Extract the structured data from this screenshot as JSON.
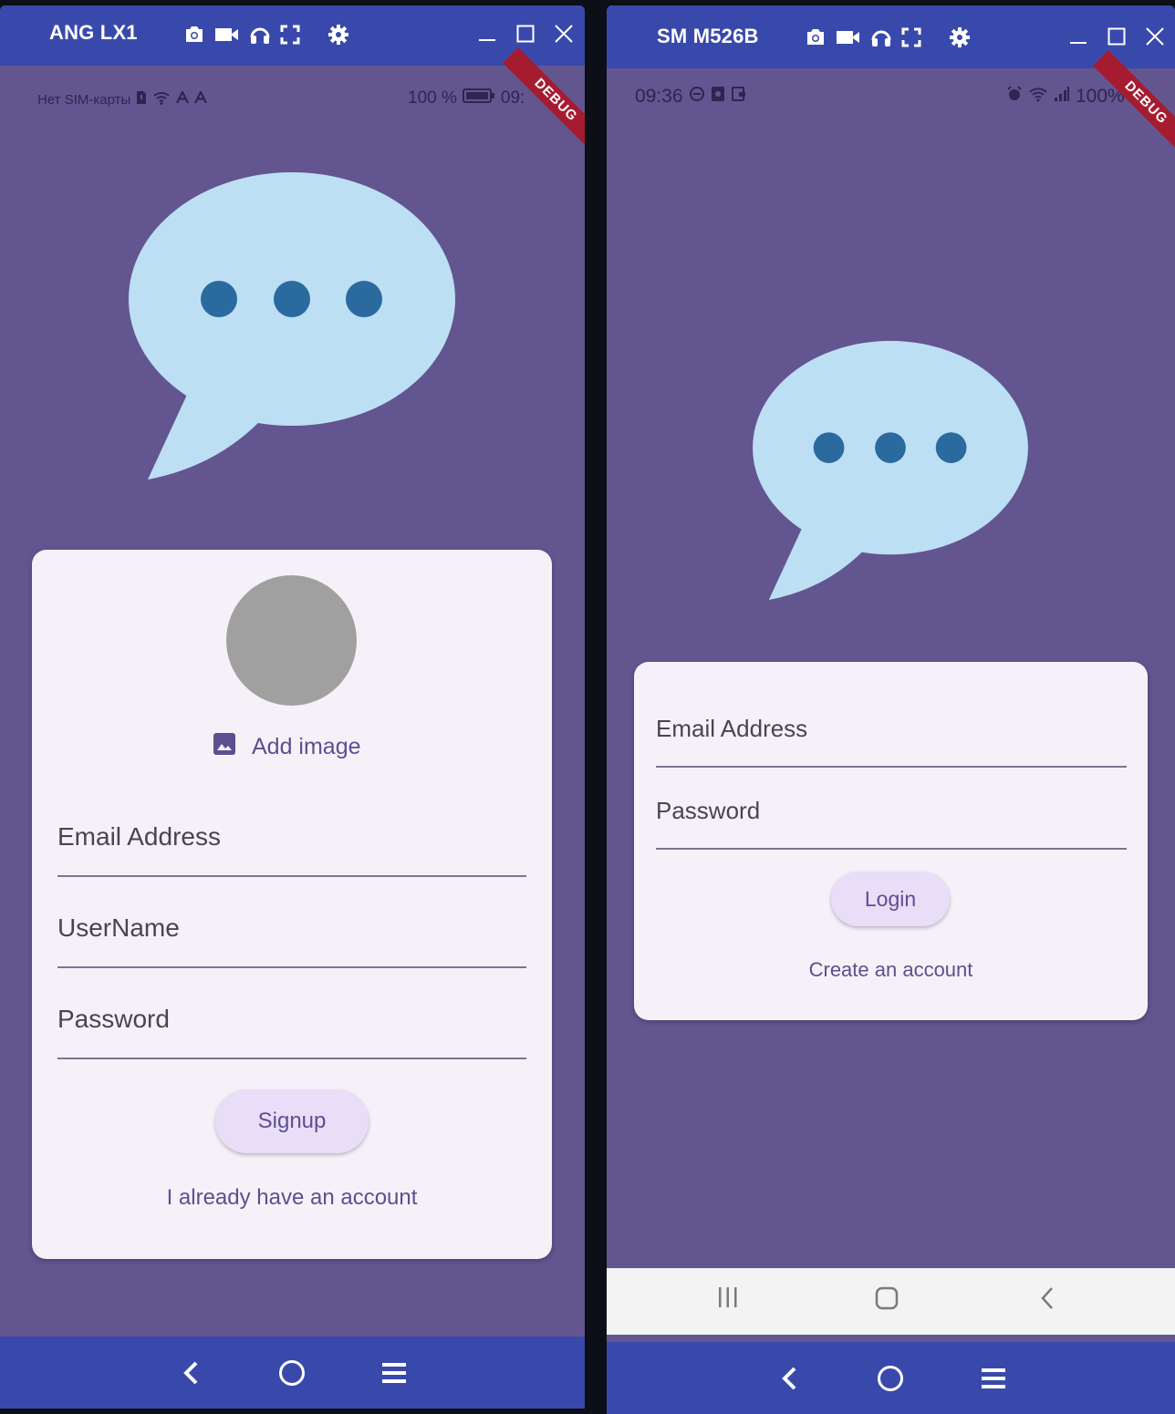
{
  "left_window": {
    "device_name": "ANG LX1",
    "status": {
      "carrier": "Нет SIM-карты",
      "battery": "100 %",
      "time_partial": "09:"
    },
    "debug_banner": "DEBUG",
    "signup": {
      "add_image_label": "Add image",
      "email_label": "Email Address",
      "username_label": "UserName",
      "password_label": "Password",
      "signup_button": "Signup",
      "have_account_link": "I already have an account"
    }
  },
  "right_window": {
    "device_name": "SM M526B",
    "status": {
      "time": "09:36",
      "battery": "100%"
    },
    "debug_banner": "DEBUG",
    "login": {
      "email_label": "Email Address",
      "password_label": "Password",
      "login_button": "Login",
      "create_account_link": "Create an account"
    }
  },
  "icons": {
    "toolbar": [
      "camera-icon",
      "video-icon",
      "headphones-icon",
      "fullscreen-icon",
      "settings-icon"
    ],
    "window_controls": [
      "minimize-icon",
      "maximize-icon",
      "close-icon"
    ],
    "bottom_nav": [
      "back-icon",
      "home-icon",
      "menu-icon"
    ],
    "android_nav": [
      "recents-icon",
      "home-icon",
      "back-icon"
    ],
    "app_logo": "chat-bubble-icon",
    "image_icon": "image-icon"
  },
  "colors": {
    "titlebar": "#3949ab",
    "app_background": "#635590",
    "card": "#f6f1f9",
    "bubble": "#bddff4",
    "bubble_dots": "#2a6a9e",
    "accent_text": "#5d4f8f",
    "button_fill": "#e8def8",
    "debug_banner": "#a51c30",
    "avatar": "#a0a0a0"
  }
}
